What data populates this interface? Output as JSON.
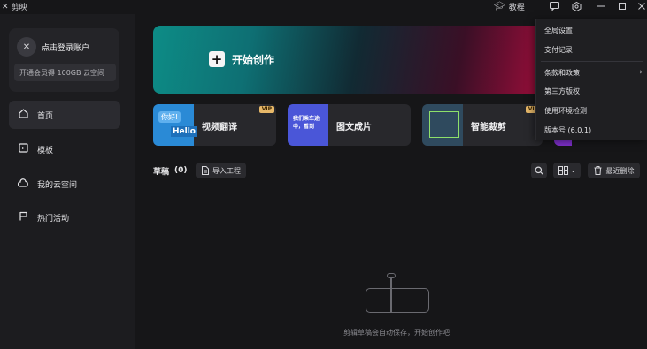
{
  "titlebar": {
    "app_name": "剪映",
    "tutorial_label": "教程",
    "icons": [
      "feedback-icon",
      "settings-icon",
      "minimize-icon",
      "maximize-icon",
      "close-icon"
    ]
  },
  "sidebar": {
    "login_text": "点击登录账户",
    "member_text": "开通会员得 100GB 云空间",
    "items": [
      {
        "label": "首页",
        "icon": "home-icon"
      },
      {
        "label": "模板",
        "icon": "template-icon"
      },
      {
        "label": "我的云空间",
        "icon": "cloud-icon"
      },
      {
        "label": "热门活动",
        "icon": "flag-icon"
      }
    ]
  },
  "hero": {
    "label": "开始创作"
  },
  "cards": [
    {
      "label": "视频翻译",
      "thumb_bubble": "你好!",
      "thumb_hello": "Hello",
      "vip": "VIP"
    },
    {
      "label": "图文成片",
      "thumb_text": "我们乘车途中，看到"
    },
    {
      "label": "智能裁剪",
      "vip": "VIP"
    }
  ],
  "drafts": {
    "title": "草稿",
    "count": "(0)",
    "import_label": "导入工程",
    "recent_delete_label": "最近删除",
    "empty_text": "剪辑草稿会自动保存，开始创作吧"
  },
  "menu": {
    "items": [
      {
        "label": "全局设置"
      },
      {
        "label": "支付记录"
      },
      {
        "label": "条款和政策",
        "has_submenu": true
      },
      {
        "label": "第三方版权"
      },
      {
        "label": "使用环境检测"
      },
      {
        "label": "版本号 (6.0.1)"
      }
    ]
  },
  "colors": {
    "background": "#161618",
    "sidebar": "#1c1c1f",
    "hero_start": "#0d8c86",
    "hero_end": "#9b0e3a",
    "vip_badge": "#e7b869"
  }
}
